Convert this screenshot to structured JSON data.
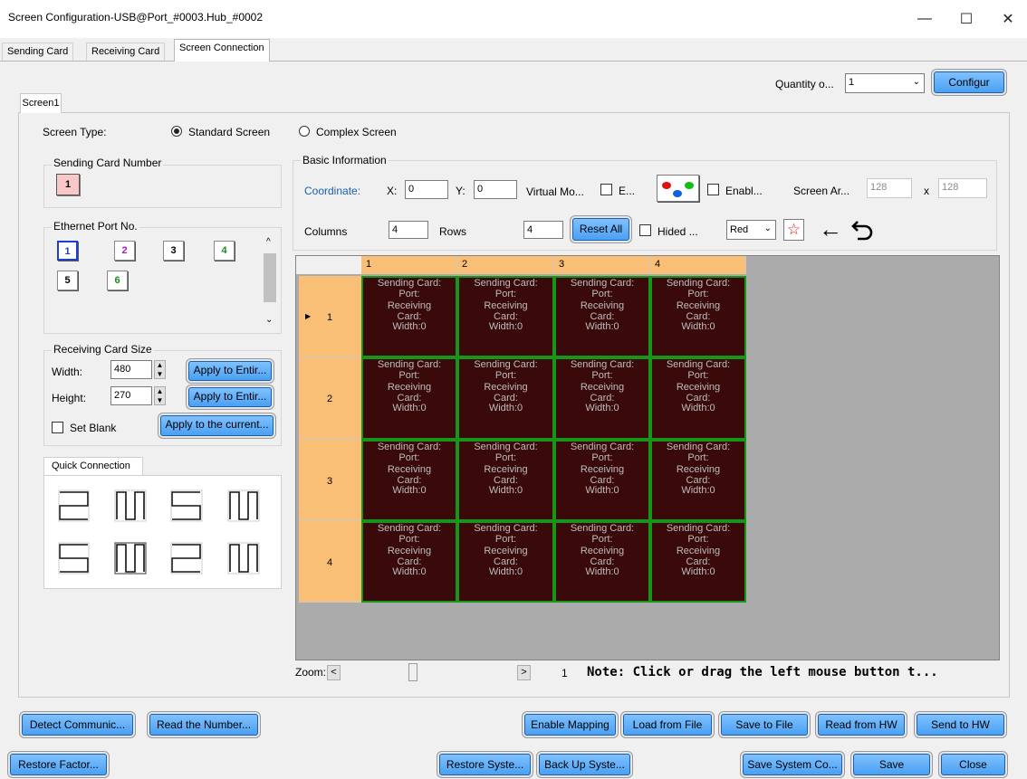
{
  "window": {
    "title": "Screen Configuration-USB@Port_#0003.Hub_#0002",
    "minimize_glyph": "—",
    "maximize_glyph": "☐",
    "close_glyph": "✕"
  },
  "tabs": [
    {
      "label": "Sending Card",
      "active": false
    },
    {
      "label": "Receiving Card",
      "active": false
    },
    {
      "label": "Screen Connection",
      "active": true
    }
  ],
  "toolbar": {
    "quantity_label": "Quantity o...",
    "quantity_value": "1",
    "configure_label": "Configur"
  },
  "screen_tab": "Screen1",
  "screen_type": {
    "label": "Screen Type:",
    "standard": "Standard Screen",
    "complex": "Complex Screen",
    "selected": "standard"
  },
  "sending_card_number": {
    "legend": "Sending Card Number",
    "value": "1"
  },
  "ethernet": {
    "legend": "Ethernet Port No.",
    "ports": [
      {
        "label": "1",
        "color": "#1f3fd0"
      },
      {
        "label": "2",
        "color": "#a020c0"
      },
      {
        "label": "3",
        "color": "#000000"
      },
      {
        "label": "4",
        "color": "#1a8a1a"
      },
      {
        "label": "5",
        "color": "#000000"
      },
      {
        "label": "6",
        "color": "#1a8a1a"
      }
    ]
  },
  "receiving_card_size": {
    "legend": "Receiving Card Size",
    "width_label": "Width:",
    "width_value": "480",
    "height_label": "Height:",
    "height_value": "270",
    "apply_width": "Apply to Entir...",
    "apply_height": "Apply to Entir...",
    "set_blank": "Set Blank",
    "apply_current": "Apply to the current..."
  },
  "quick_connection": {
    "label": "Quick Connection"
  },
  "basic_info": {
    "legend": "Basic Information",
    "coordinate_label": "Coordinate:",
    "x_label": "X:",
    "x_value": "0",
    "y_label": "Y:",
    "y_value": "0",
    "virtual_mode": "Virtual Mo...",
    "e_label": "E...",
    "enable_label": "Enabl...",
    "screen_area_label": "Screen Ar...",
    "screen_w": "128",
    "x_sep": "x",
    "screen_h": "128",
    "columns_label": "Columns",
    "columns_value": "4",
    "rows_label": "Rows",
    "rows_value": "4",
    "reset_all": "Reset All",
    "hided": "Hided ...",
    "color_value": "Red",
    "accent_color": "#1a5fb4"
  },
  "grid": {
    "col_headers": [
      "1",
      "2",
      "3",
      "4"
    ],
    "row_headers": [
      "1",
      "2",
      "3",
      "4"
    ],
    "cell_lines": [
      "Sending Card:",
      "Port:",
      "Receiving",
      "Card:",
      "Width:0"
    ],
    "cell_bg": "#3a0a0a",
    "cell_border": "#169516",
    "header_bg": "#f9bf76"
  },
  "zoom": {
    "label": "Zoom:",
    "left": "<",
    "right": ">",
    "value": "1",
    "note": "Note: Click or drag the left mouse button t..."
  },
  "bottom_row1": {
    "detect": "Detect Communic...",
    "read_number": "Read the Number...",
    "enable_mapping": "Enable Mapping",
    "load_file": "Load from File",
    "save_file": "Save to File",
    "read_hw": "Read from HW",
    "send_hw": "Send to HW"
  },
  "bottom_row2": {
    "restore_factory": "Restore Factor...",
    "restore_system": "Restore Syste...",
    "backup_system": "Back Up Syste...",
    "save_system": "Save System Co...",
    "save": "Save",
    "close": "Close"
  }
}
